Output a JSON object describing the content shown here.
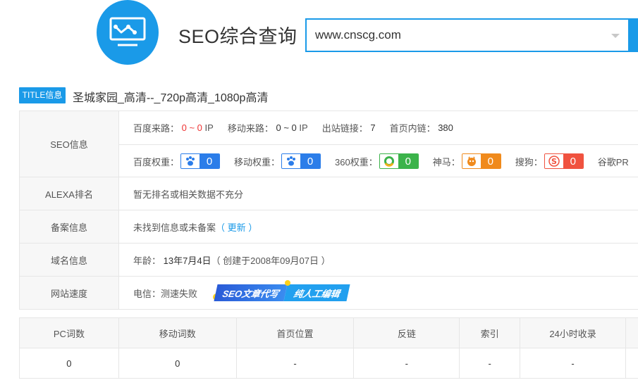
{
  "header": {
    "title": "SEO综合查询",
    "search_value": "www.cnscg.com"
  },
  "title_info": {
    "badge": "TITLE信息",
    "text": "圣城家园_高清--_720p高清_1080p高清"
  },
  "seo": {
    "label": "SEO信息",
    "baidu_source_label": "百度来路：",
    "baidu_source_value": "0 ~ 0",
    "baidu_source_unit": "IP",
    "mobile_source_label": "移动来路：",
    "mobile_source_value": "0 ~ 0",
    "mobile_source_unit": "IP",
    "outbound_label": "出站链接：",
    "outbound_value": "7",
    "inbound_label": "首页内链：",
    "inbound_value": "380",
    "baidu_weight_label": "百度权重：",
    "baidu_weight": "0",
    "mobile_weight_label": "移动权重：",
    "mobile_weight": "0",
    "weight360_label": "360权重：",
    "weight360": "0",
    "shenma_label": "神马：",
    "shenma": "0",
    "sogou_label": "搜狗：",
    "sogou": "0",
    "google_label": "谷歌PR"
  },
  "alexa": {
    "label": "ALEXA排名",
    "value": "暂无排名或相关数据不充分"
  },
  "icp": {
    "label": "备案信息",
    "value": "未找到信息或未备案",
    "link": "（ 更新 ）"
  },
  "domain": {
    "label": "域名信息",
    "age_label": "年龄：",
    "age": "13年7月4日",
    "created": "（ 创建于2008年09月07日 ）"
  },
  "speed": {
    "label": "网站速度",
    "value": "电信：测速失败",
    "promo_a": "SEO文章代写",
    "promo_b": "纯人工编辑"
  },
  "stats": {
    "headers": [
      "PC词数",
      "移动词数",
      "首页位置",
      "反链",
      "索引",
      "24小时收录"
    ],
    "values": [
      "0",
      "0",
      "-",
      "-",
      "-",
      "-"
    ]
  },
  "colors": {
    "accent": "#1a9ae8",
    "red": "#e33333"
  }
}
